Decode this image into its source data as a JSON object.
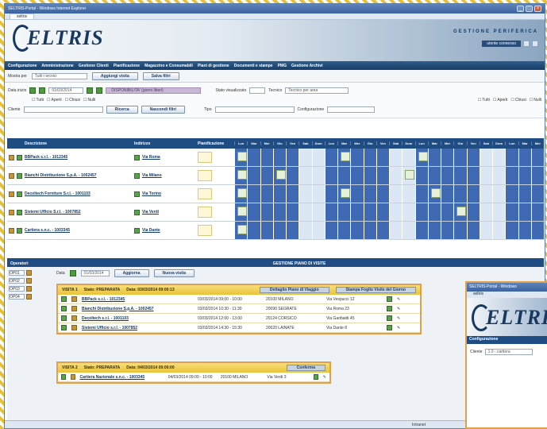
{
  "window": {
    "title": "SELTRIS-Portal - Windows Internet Explorer"
  },
  "tab": {
    "label": "seltris"
  },
  "banner": {
    "logo_text": "ELTRIS",
    "subtitle": "GESTIONE PERIFERICA",
    "user": "utente connesso"
  },
  "nav": {
    "items": [
      "Configurazione",
      "Amministrazione",
      "Gestione Clienti",
      "Pianificazione",
      "Magazzino e Consumabili",
      "Piani di gestione",
      "Documenti e stampe",
      "PMG",
      "Gestione Archivi"
    ]
  },
  "toolbar": {
    "label": "Mostra per",
    "select": "Tutti i tecnici",
    "btn_add": "Aggiungi visita",
    "btn_filter": "Salva filtri"
  },
  "filters": {
    "date_label": "Data inizio",
    "date_value": "01/03/2014",
    "purple_label": "DISPONIBILITA' (giorni liberi)",
    "type_label": "Stato visualizzato",
    "scope_label": "Tecnico",
    "scope_value": "Tecnico per area",
    "checks1": [
      "Tutti",
      "Aperti",
      "Chiusi",
      "Nulli"
    ],
    "checks2": [
      "Tutti",
      "Aperti",
      "Chiusi",
      "Nulli"
    ],
    "search_label": "Cliente",
    "btn_search": "Ricerca",
    "btn_hide": "Nascondi filtri",
    "type2_label": "Tipo",
    "conf_label": "Configurazione"
  },
  "grid": {
    "col_client": "Descrizione",
    "col_address": "Indirizzo",
    "col_plan": "Pianificazione",
    "day_headers": [
      "Lun",
      "Mar",
      "Mer",
      "Gio",
      "Ven",
      "Sab",
      "Dom",
      "Lun",
      "Mar",
      "Mer",
      "Gio",
      "Ven",
      "Sab",
      "Dom",
      "Lun",
      "Mar",
      "Mer",
      "Gio",
      "Ven",
      "Sab",
      "Dom",
      "Lun",
      "Mar",
      "Mer"
    ],
    "rows": [
      {
        "name": "BBPack s.r.l. - 1012345",
        "addr": "Via Roma"
      },
      {
        "name": "Bianchi Distribuzione S.p.A. - 1002457",
        "addr": "Via Milano"
      },
      {
        "name": "Decoltech Forniture S.r.l. - 1001103",
        "addr": "Via Torino"
      },
      {
        "name": "Sistemi Ufficio S.r.l. - 1007852",
        "addr": "Via Verdi"
      },
      {
        "name": "Cartiera s.n.c. - 1003345",
        "addr": "Via Dante"
      }
    ]
  },
  "lower": {
    "side_title": "Operatori",
    "center_title": "GESTIONE PIANO DI VISITE",
    "date_label": "Data",
    "date_value": "01/03/2014",
    "btn_a": "Aggiorna",
    "btn_b": "Nuova visita",
    "side_items": [
      "OP01",
      "OP02",
      "OP03",
      "OP04"
    ],
    "visit1": {
      "title": "VISITA 1",
      "state": "Stato: PREPARATA",
      "date": "Data: 03/03/2014 09:00:13",
      "btn1": "Dettaglio Piano di Viaggio",
      "btn2": "Stampa Foglio Visite del Giorno",
      "rows": [
        {
          "name": "BBPack s.r.l. - 1012345",
          "time": "03/03/2014 09:00 - 10:00",
          "city": "20100 MILANO",
          "addr": "Via Vespucci 12"
        },
        {
          "name": "Bianchi Distribuzione S.p.A. - 1002457",
          "time": "03/03/2014 10:30 - 11:30",
          "city": "20090 SEGRATE",
          "addr": "Via Roma 23"
        },
        {
          "name": "Decoltech s.r.l. - 1001103",
          "time": "03/03/2014 12:00 - 13:00",
          "city": "20124 CORSICO",
          "addr": "Via Garibaldi 45"
        },
        {
          "name": "Sistemi Ufficio s.r.l. - 1007852",
          "time": "03/03/2014 14:30 - 15:30",
          "city": "20020 LAINATE",
          "addr": "Via Dante 8"
        }
      ]
    },
    "visit2": {
      "title": "VISITA 2",
      "state": "Stato: PREPARATA",
      "date": "Data: 04/03/2014 09:00:00",
      "btn": "Conferma",
      "rows": [
        {
          "name": "Cartiera Nazionale s.n.c. - 1003345",
          "time": "04/03/2014 09:00 - 10:00",
          "city": "20100 MILANO",
          "addr": "Via Verdi 3"
        }
      ]
    }
  },
  "popup": {
    "title": "SELTRIS-Portal - Windows",
    "tab": "seltris",
    "logo_text": "ELTRIS",
    "nav": "Configurazione",
    "label": "Cliente",
    "value": "1.0 - cartiera"
  },
  "statusbar": {
    "zone": "Intranet"
  }
}
